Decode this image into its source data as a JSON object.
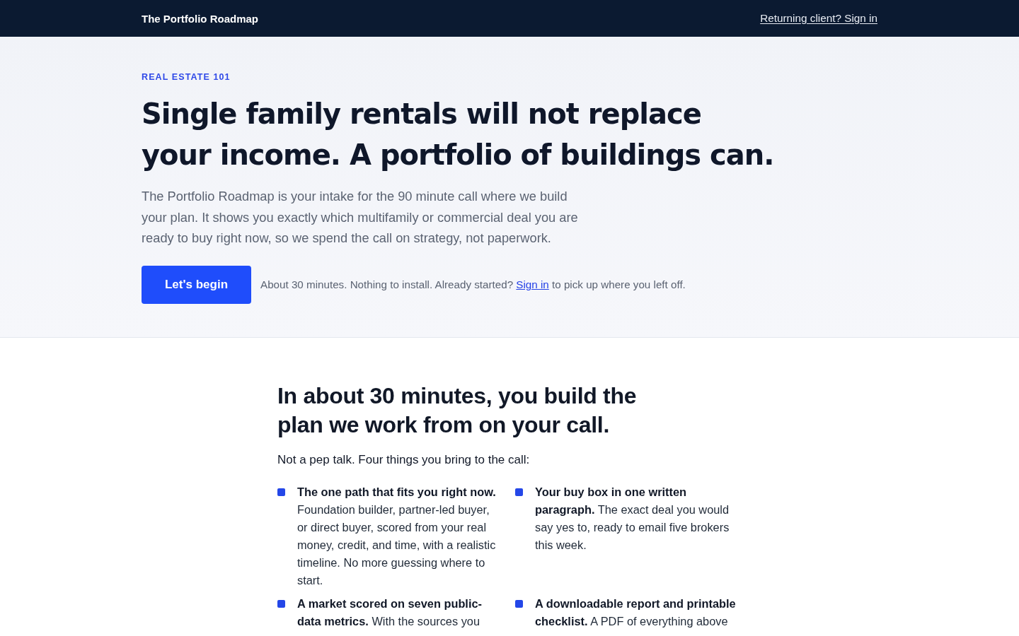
{
  "header": {
    "brand": "The Portfolio Roadmap",
    "sign_in_link": "Returning client? Sign in"
  },
  "hero": {
    "eyebrow": "REAL ESTATE 101",
    "title": "Single family rentals will not replace your income. A portfolio of buildings can.",
    "intro": "The Portfolio Roadmap is your intake for the 90 minute call where we build your plan. It shows you exactly which multifamily or commercial deal you are ready to buy right now, so we spend the call on strategy, not paperwork.",
    "cta_button": "Let's begin",
    "note": {
      "before": "About 30 minutes. Nothing to install. Already started?",
      "link": "Sign in",
      "after": "to pick up where you left off."
    }
  },
  "outcomes": {
    "title": "In about 30 minutes, you build the plan we work from on your call.",
    "lead": "Not a pep talk. Four things you bring to the call:",
    "items": [
      {
        "text": "**The one path that fits you right now.** Foundation builder, partner-led buyer, or direct buyer, scored from your real money, credit, and time, with a realistic timeline. No more guessing where to start."
      },
      {
        "text": "**Your buy box in one written paragraph.** The exact deal you would say yes to, ready to email five brokers this week."
      },
      {
        "text": "**A market scored on seven public-data metrics.** With the sources you"
      },
      {
        "text": "**A downloadable report and printable checklist.** A PDF of everything above"
      }
    ]
  }
}
